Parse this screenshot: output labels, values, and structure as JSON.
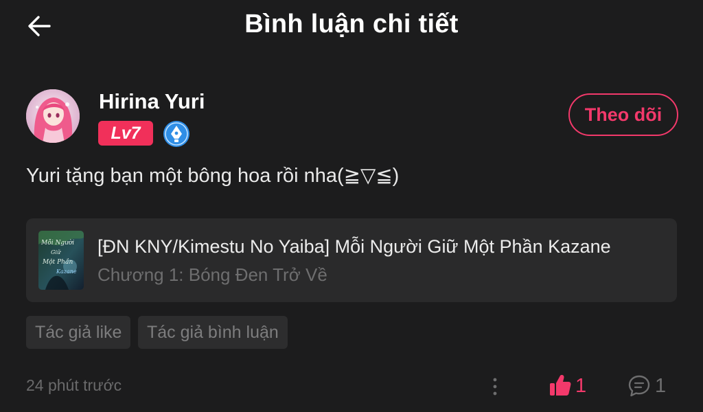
{
  "header": {
    "title": "Bình luận chi tiết",
    "back_icon": "arrow-left-icon"
  },
  "user": {
    "name": "Hirina Yuri",
    "level": "Lv7",
    "verify_icon": "pen-nib-badge-icon",
    "follow_label": "Theo dõi"
  },
  "comment": {
    "text": "Yuri tặng bạn một bông hoa rồi nha(≧▽≦)"
  },
  "book": {
    "title": "[ĐN KNY/Kimestu No Yaiba] Mỗi Người Giữ Một Phần Kazane",
    "chapter": "Chương 1: Bóng Đen Trở Về",
    "cover_text": [
      "Mỗi Người",
      "Giữ",
      "Một Phần",
      "Kazane"
    ]
  },
  "tags": [
    "Tác giả like",
    "Tác giả bình luận"
  ],
  "footer": {
    "timestamp": "24 phút trước",
    "like_count": "1",
    "reply_count": "1",
    "more_icon": "more-vertical-icon",
    "like_icon": "thumbs-up-icon",
    "reply_icon": "comment-bubble-icon"
  },
  "colors": {
    "background": "#1c1c1d",
    "accent": "#f3396b",
    "level_badge": "#f1305a",
    "verify_badge": "#2f8ee6",
    "card": "#2a2a2b"
  }
}
